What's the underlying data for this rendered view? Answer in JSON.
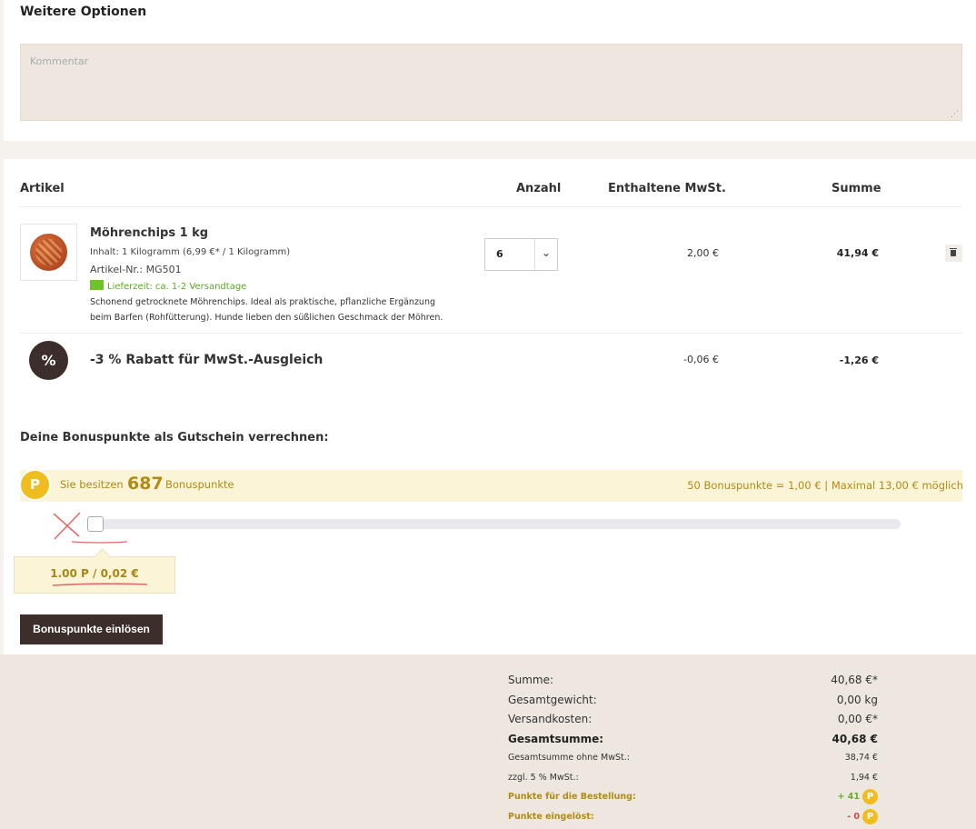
{
  "options": {
    "title": "Weitere Optionen",
    "comment_placeholder": "Kommentar"
  },
  "cart": {
    "headers": {
      "article": "Artikel",
      "quantity": "Anzahl",
      "vat": "Enthaltene MwSt.",
      "sum": "Summe"
    },
    "product": {
      "name": "Möhrenchips 1 kg",
      "content": "Inhalt: 1 Kilogramm (6,99 €* / 1 Kilogramm)",
      "article_no": "Artikel-Nr.: MG501",
      "delivery": "Lieferzeit: ca. 1-2 Versandtage",
      "description_line1": "Schonend getrocknete Möhrenchips. Ideal als praktische, pflanzliche Ergänzung",
      "description_line2": "beim Barfen (Rohfütterung). Hunde lieben den süßlichen Geschmack der Möhren.",
      "quantity": "6",
      "vat": "2,00 €",
      "sum": "41,94 €"
    },
    "discount": {
      "icon_text": "%",
      "name": "-3 % Rabatt für MwSt.-Ausgleich",
      "vat": "-0,06 €",
      "sum": "-1,26 €"
    }
  },
  "bonus": {
    "title": "Deine Bonuspunkte als Gutschein verrechnen:",
    "coin_letter": "P",
    "have_prefix": "Sie besitzen",
    "points": "687",
    "have_suffix": "Bonuspunkte",
    "rate_info": "50 Bonuspunkte = 1,00 € | Maximal 13,00 € möglich",
    "slider_value": 0.0,
    "tooltip": "1.00 P / 0,02 €",
    "redeem_label": "Bonuspunkte einlösen"
  },
  "totals": {
    "rows": [
      {
        "label": "Summe:",
        "value": "40,68 €*"
      },
      {
        "label": "Gesamtgewicht:",
        "value": "0,00 kg"
      },
      {
        "label": "Versandkosten:",
        "value": "0,00 €*"
      },
      {
        "label": "Gesamtsumme:",
        "value": "40,68 €"
      },
      {
        "label": "Gesamtsumme ohne MwSt.:",
        "value": "38,74 €"
      },
      {
        "label": "zzgl. 5 % MwSt.:",
        "value": "1,94 €"
      },
      {
        "label": "Punkte für die Bestellung:",
        "value": "+ 41"
      },
      {
        "label": "Punkte eingelöst:",
        "value": "- 0"
      }
    ]
  },
  "colors": {
    "brand_dark": "#3c2f2b",
    "gold": "#f0bd1e",
    "gold_text": "#b08b17",
    "green": "#6ec22c",
    "red": "#d9463a"
  }
}
